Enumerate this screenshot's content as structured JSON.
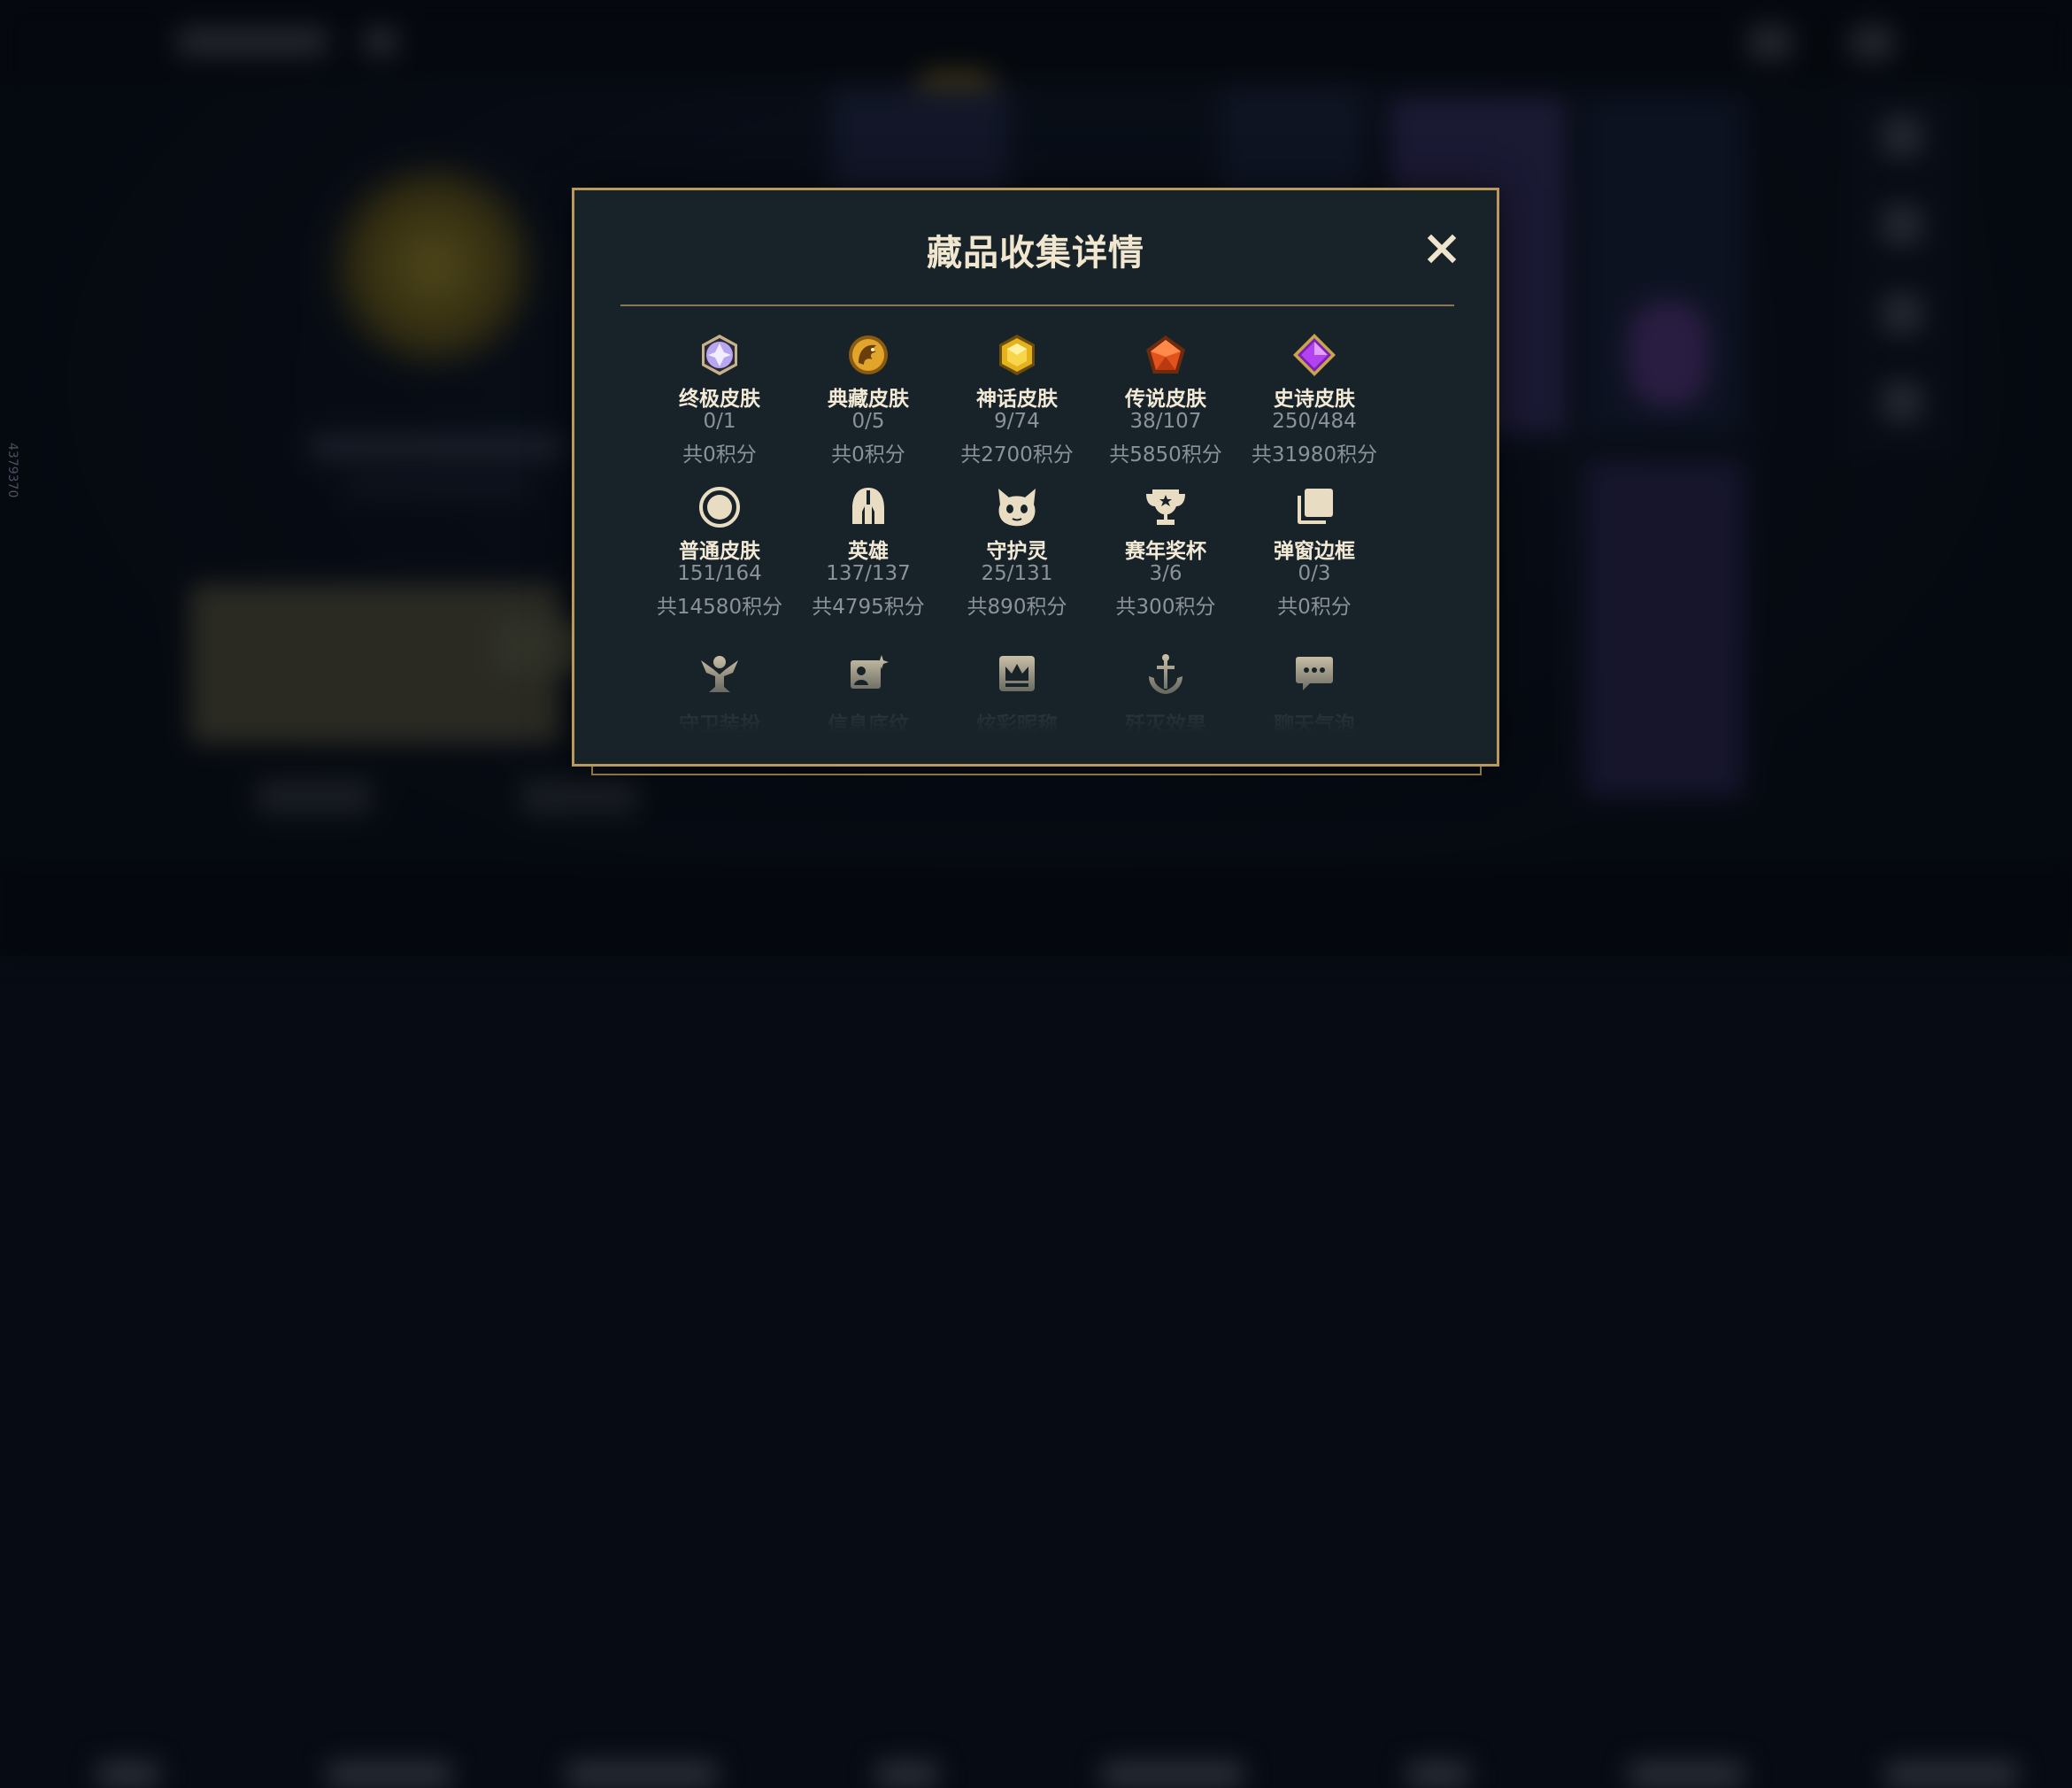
{
  "side_id": "4379370",
  "modal": {
    "title": "藏品收集详情",
    "close_icon": "close-icon"
  },
  "colors": {
    "gold_border": "#b99a5c",
    "modal_bg": "#182329",
    "title_text": "#f1e6cf",
    "muted_text": "#8b9299"
  },
  "items": [
    {
      "name": "终极皮肤",
      "count": "0/1",
      "points": "共0积分",
      "icon": "ultimate-gem-icon"
    },
    {
      "name": "典藏皮肤",
      "count": "0/5",
      "points": "共0积分",
      "icon": "dragon-emblem-icon"
    },
    {
      "name": "神话皮肤",
      "count": "9/74",
      "points": "共2700积分",
      "icon": "mythic-gem-icon"
    },
    {
      "name": "传说皮肤",
      "count": "38/107",
      "points": "共5850积分",
      "icon": "legendary-gem-icon"
    },
    {
      "name": "史诗皮肤",
      "count": "250/484",
      "points": "共31980积分",
      "icon": "epic-gem-icon"
    },
    {
      "name": "普通皮肤",
      "count": "151/164",
      "points": "共14580积分",
      "icon": "ring-icon"
    },
    {
      "name": "英雄",
      "count": "137/137",
      "points": "共4795积分",
      "icon": "helmet-icon"
    },
    {
      "name": "守护灵",
      "count": "25/131",
      "points": "共890积分",
      "icon": "spirit-icon"
    },
    {
      "name": "赛年奖杯",
      "count": "3/6",
      "points": "共300积分",
      "icon": "trophy-icon"
    },
    {
      "name": "弹窗边框",
      "count": "0/3",
      "points": "共0积分",
      "icon": "frames-icon"
    },
    {
      "name": "守卫装扮",
      "icon": "ward-icon"
    },
    {
      "name": "信息底纹",
      "icon": "card-sparkle-icon"
    },
    {
      "name": "炫彩昵称",
      "icon": "crown-card-icon"
    },
    {
      "name": "歼灭效果",
      "icon": "anchor-icon"
    },
    {
      "name": "聊天气泡",
      "icon": "chat-bubble-icon"
    }
  ]
}
